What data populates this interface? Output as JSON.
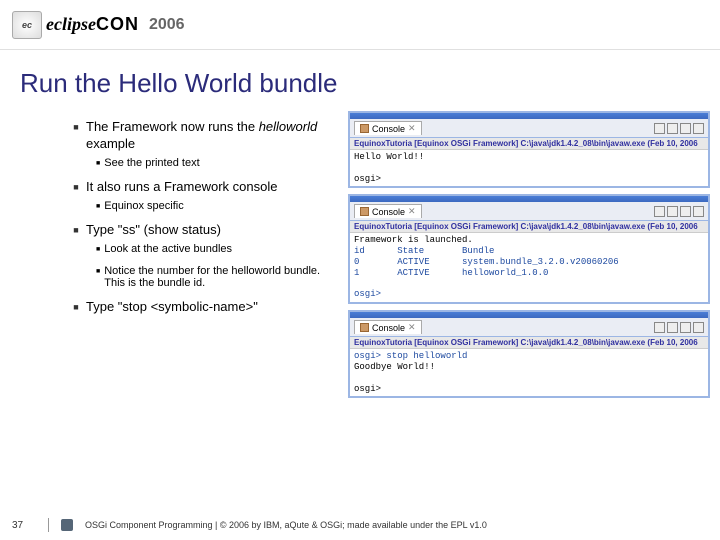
{
  "header": {
    "logo_part1": "eclipse",
    "logo_part2": "CON",
    "year": "2006"
  },
  "title": "Run the Hello World bundle",
  "bullets": {
    "b1a": "The Framework now runs the ",
    "b1a_italic": "helloworld",
    "b1a_tail": " example",
    "b1a_sub": "See the printed text",
    "b2": "It also runs a Framework console",
    "b2_sub": "Equinox specific",
    "b3": "Type \"ss\" (show status)",
    "b3_sub1": "Look at the active bundles",
    "b3_sub2": "Notice the number for the helloworld bundle. This is the bundle id.",
    "b4": "Type \"stop <symbolic-name>\""
  },
  "console": {
    "tab_label": "Console",
    "toolbar1": "EquinoxTutoria [Equinox OSGi Framework] C:\\java\\jdk1.4.2_08\\bin\\javaw.exe (Feb 10, 2006",
    "body1": "Hello World!!\n\nosgi>",
    "toolbar2": "EquinoxTutoria [Equinox OSGi Framework] C:\\java\\jdk1.4.2_08\\bin\\javaw.exe (Feb 10, 2006",
    "body2_head": "Framework is launched.",
    "body2_table": "id      State       Bundle\n0       ACTIVE      system.bundle_3.2.0.v20060206\n1       ACTIVE      helloworld_1.0.0\n\nosgi>",
    "toolbar3": "EquinoxTutoria [Equinox OSGi Framework] C:\\java\\jdk1.4.2_08\\bin\\javaw.exe (Feb 10, 2006",
    "body3_cmd": "osgi> stop helloworld",
    "body3_out": "Goodbye World!!\n\nosgi>"
  },
  "footer": {
    "page": "37",
    "text": "OSGi Component Programming | © 2006 by IBM, aQute & OSGi; made available under the EPL v1.0"
  }
}
